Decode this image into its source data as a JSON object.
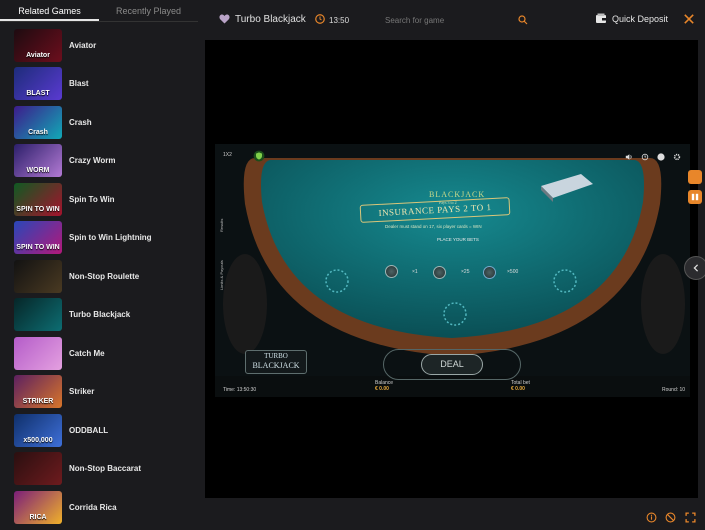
{
  "sidebar": {
    "tabs": [
      {
        "label": "Related Games",
        "active": true
      },
      {
        "label": "Recently Played",
        "active": false
      }
    ],
    "games": [
      {
        "name": "Aviator",
        "thumb_text": "Aviator",
        "colors": [
          "#1d0b10",
          "#6d0e1d"
        ]
      },
      {
        "name": "Blast",
        "thumb_text": "BLAST",
        "colors": [
          "#1d2c7a",
          "#5a3ad1"
        ]
      },
      {
        "name": "Crash",
        "thumb_text": "Crash",
        "colors": [
          "#3d1b8b",
          "#11a9b6"
        ]
      },
      {
        "name": "Crazy Worm",
        "thumb_text": "WORM",
        "colors": [
          "#2c1f6a",
          "#b37ad4"
        ]
      },
      {
        "name": "Spin To Win",
        "thumb_text": "SPIN TO WIN",
        "colors": [
          "#0f5a22",
          "#a6122d"
        ]
      },
      {
        "name": "Spin to Win Lightning",
        "thumb_text": "SPIN TO WIN",
        "colors": [
          "#2947b8",
          "#b3187a"
        ]
      },
      {
        "name": "Non-Stop Roulette",
        "thumb_text": "",
        "colors": [
          "#121212",
          "#4a3a22"
        ]
      },
      {
        "name": "Turbo Blackjack",
        "thumb_text": "",
        "colors": [
          "#062628",
          "#0d6d72"
        ]
      },
      {
        "name": "Catch Me",
        "thumb_text": "",
        "colors": [
          "#b45cc9",
          "#e4a0e0"
        ]
      },
      {
        "name": "Striker",
        "thumb_text": "STRIKER",
        "colors": [
          "#5c2060",
          "#d8752a"
        ]
      },
      {
        "name": "ODDBALL",
        "thumb_text": "x500,000",
        "colors": [
          "#0f2f6a",
          "#3e6fd8"
        ]
      },
      {
        "name": "Non-Stop Baccarat",
        "thumb_text": "",
        "colors": [
          "#2a0f10",
          "#6e1b1e"
        ]
      },
      {
        "name": "Corrida Rica",
        "thumb_text": "RICA",
        "colors": [
          "#7b1e7a",
          "#f0b12a"
        ]
      }
    ]
  },
  "topbar": {
    "game_title": "Turbo Blackjack",
    "time": "13:50",
    "search_placeholder": "Search for game",
    "deposit_label": "Quick Deposit"
  },
  "game": {
    "table_title": "BLACKJACK",
    "table_subtitle": "Pays 3 to 2",
    "insurance": "INSURANCE PAYS 2 TO 1",
    "dealer_rule": "Dealer must stand on 17, six player cards = WIN",
    "place_bets": "PLACE YOUR BETS",
    "deal": "DEAL",
    "logo_top": "TURBO",
    "logo_bottom": "BLACKJACK",
    "chips": [
      "×1",
      "×5",
      "×25",
      "×100",
      "×500"
    ],
    "balance_label": "Balance",
    "balance_value": "€ 0.00",
    "total_bet_label": "Total bet",
    "total_bet_value": "€ 0.00",
    "time_label": "Time: 13:50:30",
    "round_label": "Round: 10",
    "side_labels": [
      "Results",
      "Limits & Payouts"
    ]
  },
  "colors": {
    "accent": "#e8862a",
    "felt": "#0f6870",
    "rail": "#6b3b1e"
  }
}
